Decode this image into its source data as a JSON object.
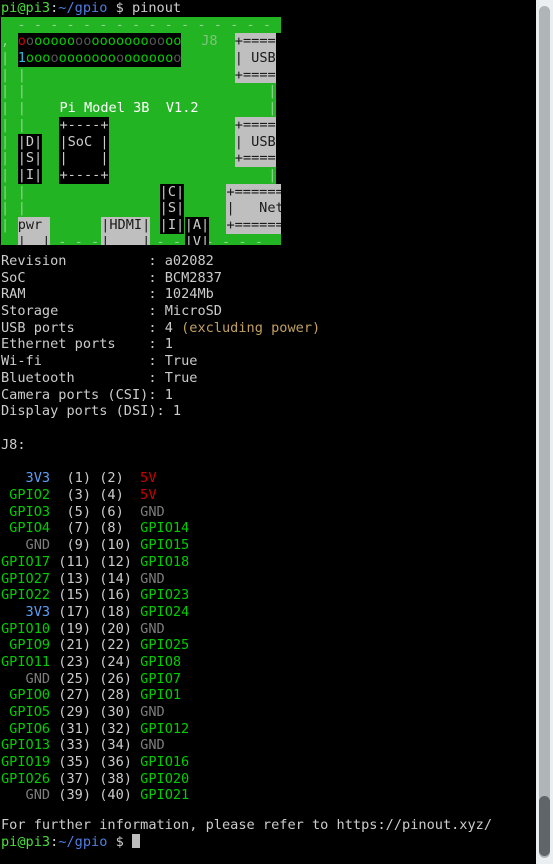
{
  "terminal": {
    "prompt_user": "pi@pi3",
    "prompt_colon": ":",
    "prompt_path": "~/gpio",
    "prompt_symbol": "$",
    "command": "pinout",
    "footer": "For further information, please refer to https://pinout.xyz/",
    "cursor": " "
  },
  "board": {
    "model_label": "Pi Model 3B  V1.2",
    "header_label": "J8",
    "soc_label": "SoC",
    "dsi_label": [
      "|D|",
      "|S|",
      "|I|"
    ],
    "csi_label": [
      "|C|",
      "|S|",
      "|I|"
    ],
    "av_label": [
      "|A|",
      "|V|"
    ],
    "hdmi_label": "|HDMI|",
    "pwr_label": "pwr",
    "usb_top_label": "| USB",
    "usb_bottom_label": "| USB",
    "net_label": "|   Net",
    "usb_border": "+====",
    "net_border": "+======",
    "pin_row_top": "oooooooooooooooooooo",
    "pin_row_bottom": "1ooooooooooooooooooo",
    "pin_colors_top": [
      "red",
      "grey",
      "green",
      "green",
      "green",
      "green",
      "green",
      "grey",
      "grey",
      "green",
      "green",
      "green",
      "green",
      "green",
      "green",
      "green",
      "grey",
      "grey",
      "green",
      "green"
    ],
    "pin_colors_bottom": [
      "cyan",
      "green",
      "green",
      "green",
      "grey",
      "green",
      "green",
      "green",
      "green",
      "green",
      "green",
      "green",
      "grey",
      "green",
      "green",
      "green",
      "green",
      "green",
      "green",
      "grey"
    ]
  },
  "info": {
    "rows": [
      {
        "label": "Revision",
        "sep": ":",
        "value": "a02082",
        "suffix": ""
      },
      {
        "label": "SoC",
        "sep": ":",
        "value": "BCM2837",
        "suffix": ""
      },
      {
        "label": "RAM",
        "sep": ":",
        "value": "1024Mb",
        "suffix": ""
      },
      {
        "label": "Storage",
        "sep": ":",
        "value": "MicroSD",
        "suffix": ""
      },
      {
        "label": "USB ports",
        "sep": ":",
        "value": "4",
        "suffix": "(excluding power)"
      },
      {
        "label": "Ethernet ports",
        "sep": ":",
        "value": "1",
        "suffix": ""
      },
      {
        "label": "Wi-fi",
        "sep": ":",
        "value": "True",
        "suffix": ""
      },
      {
        "label": "Bluetooth",
        "sep": ":",
        "value": "True",
        "suffix": ""
      },
      {
        "label": "Camera ports (CSI)",
        "sep": ":",
        "value": "1",
        "suffix": ""
      },
      {
        "label": "Display ports (DSI)",
        "sep": ":",
        "value": "1",
        "suffix": ""
      }
    ]
  },
  "j8": {
    "title": "J8:",
    "pins": [
      {
        "left": "3V3",
        "left_type": "v33",
        "ln": "(1)",
        "rn": "(2)",
        "right": "5V",
        "right_type": "v5"
      },
      {
        "left": "GPIO2",
        "left_type": "gpio",
        "ln": "(3)",
        "rn": "(4)",
        "right": "5V",
        "right_type": "v5"
      },
      {
        "left": "GPIO3",
        "left_type": "gpio",
        "ln": "(5)",
        "rn": "(6)",
        "right": "GND",
        "right_type": "gnd"
      },
      {
        "left": "GPIO4",
        "left_type": "gpio",
        "ln": "(7)",
        "rn": "(8)",
        "right": "GPIO14",
        "right_type": "gpio"
      },
      {
        "left": "GND",
        "left_type": "gnd",
        "ln": "(9)",
        "rn": "(10)",
        "right": "GPIO15",
        "right_type": "gpio"
      },
      {
        "left": "GPIO17",
        "left_type": "gpio",
        "ln": "(11)",
        "rn": "(12)",
        "right": "GPIO18",
        "right_type": "gpio"
      },
      {
        "left": "GPIO27",
        "left_type": "gpio",
        "ln": "(13)",
        "rn": "(14)",
        "right": "GND",
        "right_type": "gnd"
      },
      {
        "left": "GPIO22",
        "left_type": "gpio",
        "ln": "(15)",
        "rn": "(16)",
        "right": "GPIO23",
        "right_type": "gpio"
      },
      {
        "left": "3V3",
        "left_type": "v33",
        "ln": "(17)",
        "rn": "(18)",
        "right": "GPIO24",
        "right_type": "gpio"
      },
      {
        "left": "GPIO10",
        "left_type": "gpio",
        "ln": "(19)",
        "rn": "(20)",
        "right": "GND",
        "right_type": "gnd"
      },
      {
        "left": "GPIO9",
        "left_type": "gpio",
        "ln": "(21)",
        "rn": "(22)",
        "right": "GPIO25",
        "right_type": "gpio"
      },
      {
        "left": "GPIO11",
        "left_type": "gpio",
        "ln": "(23)",
        "rn": "(24)",
        "right": "GPIO8",
        "right_type": "gpio"
      },
      {
        "left": "GND",
        "left_type": "gnd",
        "ln": "(25)",
        "rn": "(26)",
        "right": "GPIO7",
        "right_type": "gpio"
      },
      {
        "left": "GPIO0",
        "left_type": "gpio",
        "ln": "(27)",
        "rn": "(28)",
        "right": "GPIO1",
        "right_type": "gpio"
      },
      {
        "left": "GPIO5",
        "left_type": "gpio",
        "ln": "(29)",
        "rn": "(30)",
        "right": "GND",
        "right_type": "gnd"
      },
      {
        "left": "GPIO6",
        "left_type": "gpio",
        "ln": "(31)",
        "rn": "(32)",
        "right": "GPIO12",
        "right_type": "gpio"
      },
      {
        "left": "GPIO13",
        "left_type": "gpio",
        "ln": "(33)",
        "rn": "(34)",
        "right": "GND",
        "right_type": "gnd"
      },
      {
        "left": "GPIO19",
        "left_type": "gpio",
        "ln": "(35)",
        "rn": "(36)",
        "right": "GPIO16",
        "right_type": "gpio"
      },
      {
        "left": "GPIO26",
        "left_type": "gpio",
        "ln": "(37)",
        "rn": "(38)",
        "right": "GPIO20",
        "right_type": "gpio"
      },
      {
        "left": "GND",
        "left_type": "gnd",
        "ln": "(39)",
        "rn": "(40)",
        "right": "GPIO21",
        "right_type": "gpio"
      }
    ]
  },
  "colors": {
    "pcb_green": "#22b422",
    "silk_grey": "#bfbfbf",
    "pin_red": "#cd0000",
    "pin_green": "#00cd00",
    "pin_blue": "#2fb8d8",
    "pin_gnd": "#7d7d7d",
    "terminal_bg": "#000000",
    "terminal_fg": "#cccccc",
    "prompt_green": "#4ade3c",
    "prompt_blue": "#4f7fe0",
    "note_tan": "#c0a060"
  }
}
